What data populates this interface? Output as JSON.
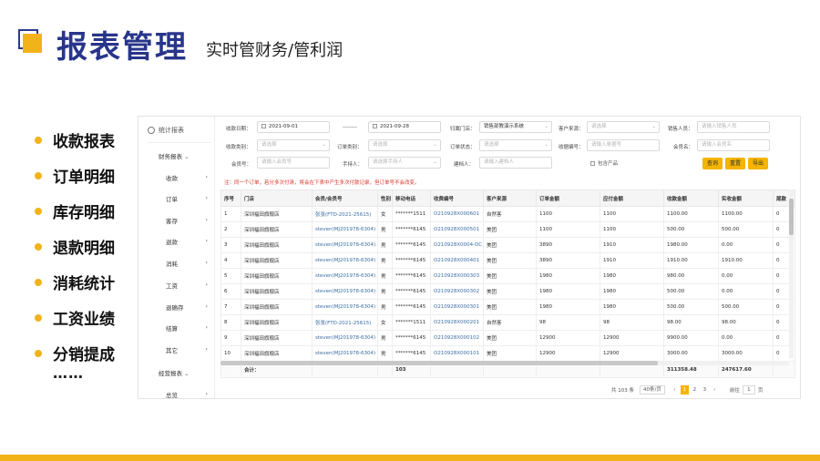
{
  "slide": {
    "title": "报表管理",
    "subtitle": "实时管财务/管利润",
    "bullets": [
      "收款报表",
      "订单明细",
      "库存明细",
      "退款明细",
      "消耗统计",
      "工资业绩",
      "分销提成"
    ],
    "ellipsis": "……",
    "accent_color": "#f2b31a",
    "title_color": "#28358a"
  },
  "app": {
    "sidebar": {
      "header": "统计报表",
      "header_icon": "clock-icon",
      "group1": "财务报表",
      "items": [
        "收款",
        "订单",
        "客存",
        "退款",
        "消耗",
        "工资",
        "退确存",
        "结算",
        "其它"
      ],
      "group2": "经营报表",
      "item_last": "总览"
    },
    "filters": {
      "start_label": "收款日期：",
      "start_value": "2021-09-01",
      "sep_label": "--------",
      "end_value": "2021-09-28",
      "store_label": "归属门店：",
      "store_value": "销售部教演示系统",
      "source_label": "客户来源：",
      "source_ph": "请选择",
      "sales_label": "销售人员：",
      "sales_ph": "请输入销售人员",
      "type_label": "收款类别：",
      "type_ph": "请选择",
      "ordertype_label": "订单类别：",
      "ordertype_ph": "请选择",
      "orderstatus_label": "订单状态：",
      "orderstatus_ph": "请选择",
      "receipt_label": "收据编号：",
      "receipt_ph": "请输入单据号",
      "member_label": "会员名：",
      "member_ph": "请输入会员名",
      "memberno_label": "会员号：",
      "memberno_ph": "请输入会员号",
      "handler_label": "手持人：",
      "handler_ph": "请选择手持人",
      "creator_label": "建档人：",
      "creator_ph": "请输入建档人",
      "include_label": "包含产品",
      "query_btn": "查询",
      "reset_btn": "重置",
      "export_btn": "导出"
    },
    "note": "注：同一个订单，若分多次付清，将会在下表中产生多次付款记录，但订单号不会改变。",
    "table": {
      "columns": [
        "序号",
        "门店",
        "会员/会员号",
        "性别",
        "移动电话",
        "收费编号",
        "客户来源",
        "订单金额",
        "应付金额",
        "收款金额",
        "实收金额",
        "尾款"
      ],
      "rows": [
        [
          "1",
          "深圳福田旗舰店",
          "张张(FTD-2021-25615)",
          "女",
          "*******1511",
          "O210928X000601",
          "自然客",
          "1100",
          "1100",
          "1100.00",
          "1100.00",
          "0"
        ],
        [
          "2",
          "深圳福田旗舰店",
          "steven(MJ201978-6304)",
          "男",
          "*******6145",
          "O210928X000501",
          "美团",
          "1100",
          "1100",
          "500.00",
          "500.00",
          "0"
        ],
        [
          "3",
          "深圳福田旗舰店",
          "steven(MJ201978-6304)",
          "男",
          "*******6145",
          "O210928X0004-DC",
          "美团",
          "3890",
          "1910",
          "1980.00",
          "0.00",
          "0"
        ],
        [
          "4",
          "深圳福田旗舰店",
          "steven(MJ201978-6304)",
          "男",
          "*******6145",
          "O210928X000401",
          "美团",
          "3890",
          "1910",
          "1910.00",
          "1910.00",
          "0"
        ],
        [
          "5",
          "深圳福田旗舰店",
          "steven(MJ201978-6304)",
          "男",
          "*******6145",
          "O210928X000303",
          "美团",
          "1980",
          "1980",
          "980.00",
          "0.00",
          "0"
        ],
        [
          "6",
          "深圳福田旗舰店",
          "steven(MJ201978-6304)",
          "男",
          "*******6145",
          "O210928X000302",
          "美团",
          "1980",
          "1980",
          "500.00",
          "0.00",
          "0"
        ],
        [
          "7",
          "深圳福田旗舰店",
          "steven(MJ201978-6304)",
          "男",
          "*******6145",
          "O210928X000301",
          "美团",
          "1980",
          "1980",
          "500.00",
          "500.00",
          "0"
        ],
        [
          "8",
          "深圳福田旗舰店",
          "张张(FTD-2021-25615)",
          "女",
          "*******1511",
          "O210928X000201",
          "自然客",
          "98",
          "98",
          "98.00",
          "98.00",
          "0"
        ],
        [
          "9",
          "深圳福田旗舰店",
          "steven(MJ201978-6304)",
          "男",
          "*******6145",
          "O210928X000102",
          "美团",
          "12900",
          "12900",
          "9900.00",
          "0.00",
          "0"
        ],
        [
          "10",
          "深圳福田旗舰店",
          "steven(MJ201978-6304)",
          "男",
          "*******6145",
          "O210928X000101",
          "美团",
          "12900",
          "12900",
          "3000.00",
          "3000.00",
          "0"
        ]
      ],
      "total_label": "合计：",
      "total_phone": "103",
      "total_received": "311358.48",
      "total_actual": "247617.60"
    },
    "pager": {
      "total": "共 103 条",
      "page_size": "40条/页",
      "prev": "‹",
      "pages": [
        "1",
        "2",
        "3"
      ],
      "next": "›",
      "goto_label": "前往",
      "goto_value": "1",
      "page_suffix": "页"
    }
  }
}
